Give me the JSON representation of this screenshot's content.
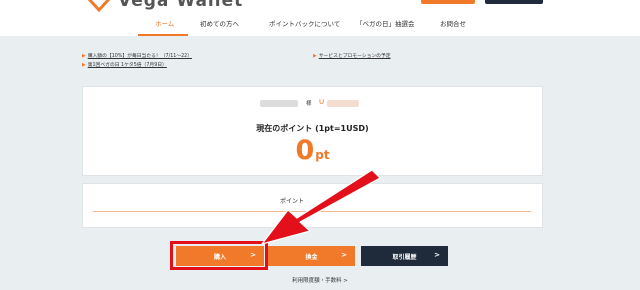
{
  "header": {
    "logo_text": "Vega Wallet",
    "nav": [
      {
        "label": "ホーム",
        "active": true
      },
      {
        "label": "初めての方へ",
        "active": false
      },
      {
        "label": "ポイントバックについて",
        "active": false
      },
      {
        "label": "「ベガの日」抽選会",
        "active": false
      },
      {
        "label": "お問合せ",
        "active": false
      }
    ]
  },
  "notices": {
    "left": [
      "購入額の【10%】が毎日当たる！（7/11～22）",
      "第1回ベガの日 1ケタ5倍（7月9日）"
    ],
    "right": [
      "サービスとプロモーションの予定"
    ]
  },
  "account": {
    "sama": "様",
    "id_prefix": "U"
  },
  "points": {
    "label": "現在のポイント (1pt=1USD)",
    "value": "0",
    "unit": "pt"
  },
  "rate_card": {
    "label": "ポイント"
  },
  "actions": {
    "buy": "購入",
    "exchange": "換金",
    "history": "取引履歴",
    "chevron": ">"
  },
  "footer": {
    "link": "利用限度額・手数料 >"
  },
  "colors": {
    "accent": "#f07a2a",
    "navy": "#1f2b3a",
    "annotation_red": "#e3101b",
    "background": "#e9eef1"
  }
}
